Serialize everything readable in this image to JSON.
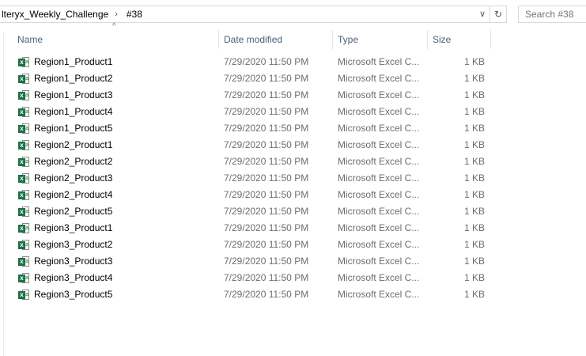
{
  "address": {
    "crumbs": [
      "lteryx_Weekly_Challenge",
      "#38"
    ],
    "dropdown_icon": "chevron-down-icon",
    "refresh_icon": "refresh-icon"
  },
  "search": {
    "placeholder": "Search #38"
  },
  "columns": {
    "name": "Name",
    "date": "Date modified",
    "type": "Type",
    "size": "Size"
  },
  "files": [
    {
      "name": "Region1_Product1",
      "date": "7/29/2020 11:50 PM",
      "type": "Microsoft Excel C...",
      "size": "1 KB"
    },
    {
      "name": "Region1_Product2",
      "date": "7/29/2020 11:50 PM",
      "type": "Microsoft Excel C...",
      "size": "1 KB"
    },
    {
      "name": "Region1_Product3",
      "date": "7/29/2020 11:50 PM",
      "type": "Microsoft Excel C...",
      "size": "1 KB"
    },
    {
      "name": "Region1_Product4",
      "date": "7/29/2020 11:50 PM",
      "type": "Microsoft Excel C...",
      "size": "1 KB"
    },
    {
      "name": "Region1_Product5",
      "date": "7/29/2020 11:50 PM",
      "type": "Microsoft Excel C...",
      "size": "1 KB"
    },
    {
      "name": "Region2_Product1",
      "date": "7/29/2020 11:50 PM",
      "type": "Microsoft Excel C...",
      "size": "1 KB"
    },
    {
      "name": "Region2_Product2",
      "date": "7/29/2020 11:50 PM",
      "type": "Microsoft Excel C...",
      "size": "1 KB"
    },
    {
      "name": "Region2_Product3",
      "date": "7/29/2020 11:50 PM",
      "type": "Microsoft Excel C...",
      "size": "1 KB"
    },
    {
      "name": "Region2_Product4",
      "date": "7/29/2020 11:50 PM",
      "type": "Microsoft Excel C...",
      "size": "1 KB"
    },
    {
      "name": "Region2_Product5",
      "date": "7/29/2020 11:50 PM",
      "type": "Microsoft Excel C...",
      "size": "1 KB"
    },
    {
      "name": "Region3_Product1",
      "date": "7/29/2020 11:50 PM",
      "type": "Microsoft Excel C...",
      "size": "1 KB"
    },
    {
      "name": "Region3_Product2",
      "date": "7/29/2020 11:50 PM",
      "type": "Microsoft Excel C...",
      "size": "1 KB"
    },
    {
      "name": "Region3_Product3",
      "date": "7/29/2020 11:50 PM",
      "type": "Microsoft Excel C...",
      "size": "1 KB"
    },
    {
      "name": "Region3_Product4",
      "date": "7/29/2020 11:50 PM",
      "type": "Microsoft Excel C...",
      "size": "1 KB"
    },
    {
      "name": "Region3_Product5",
      "date": "7/29/2020 11:50 PM",
      "type": "Microsoft Excel C...",
      "size": "1 KB"
    }
  ]
}
